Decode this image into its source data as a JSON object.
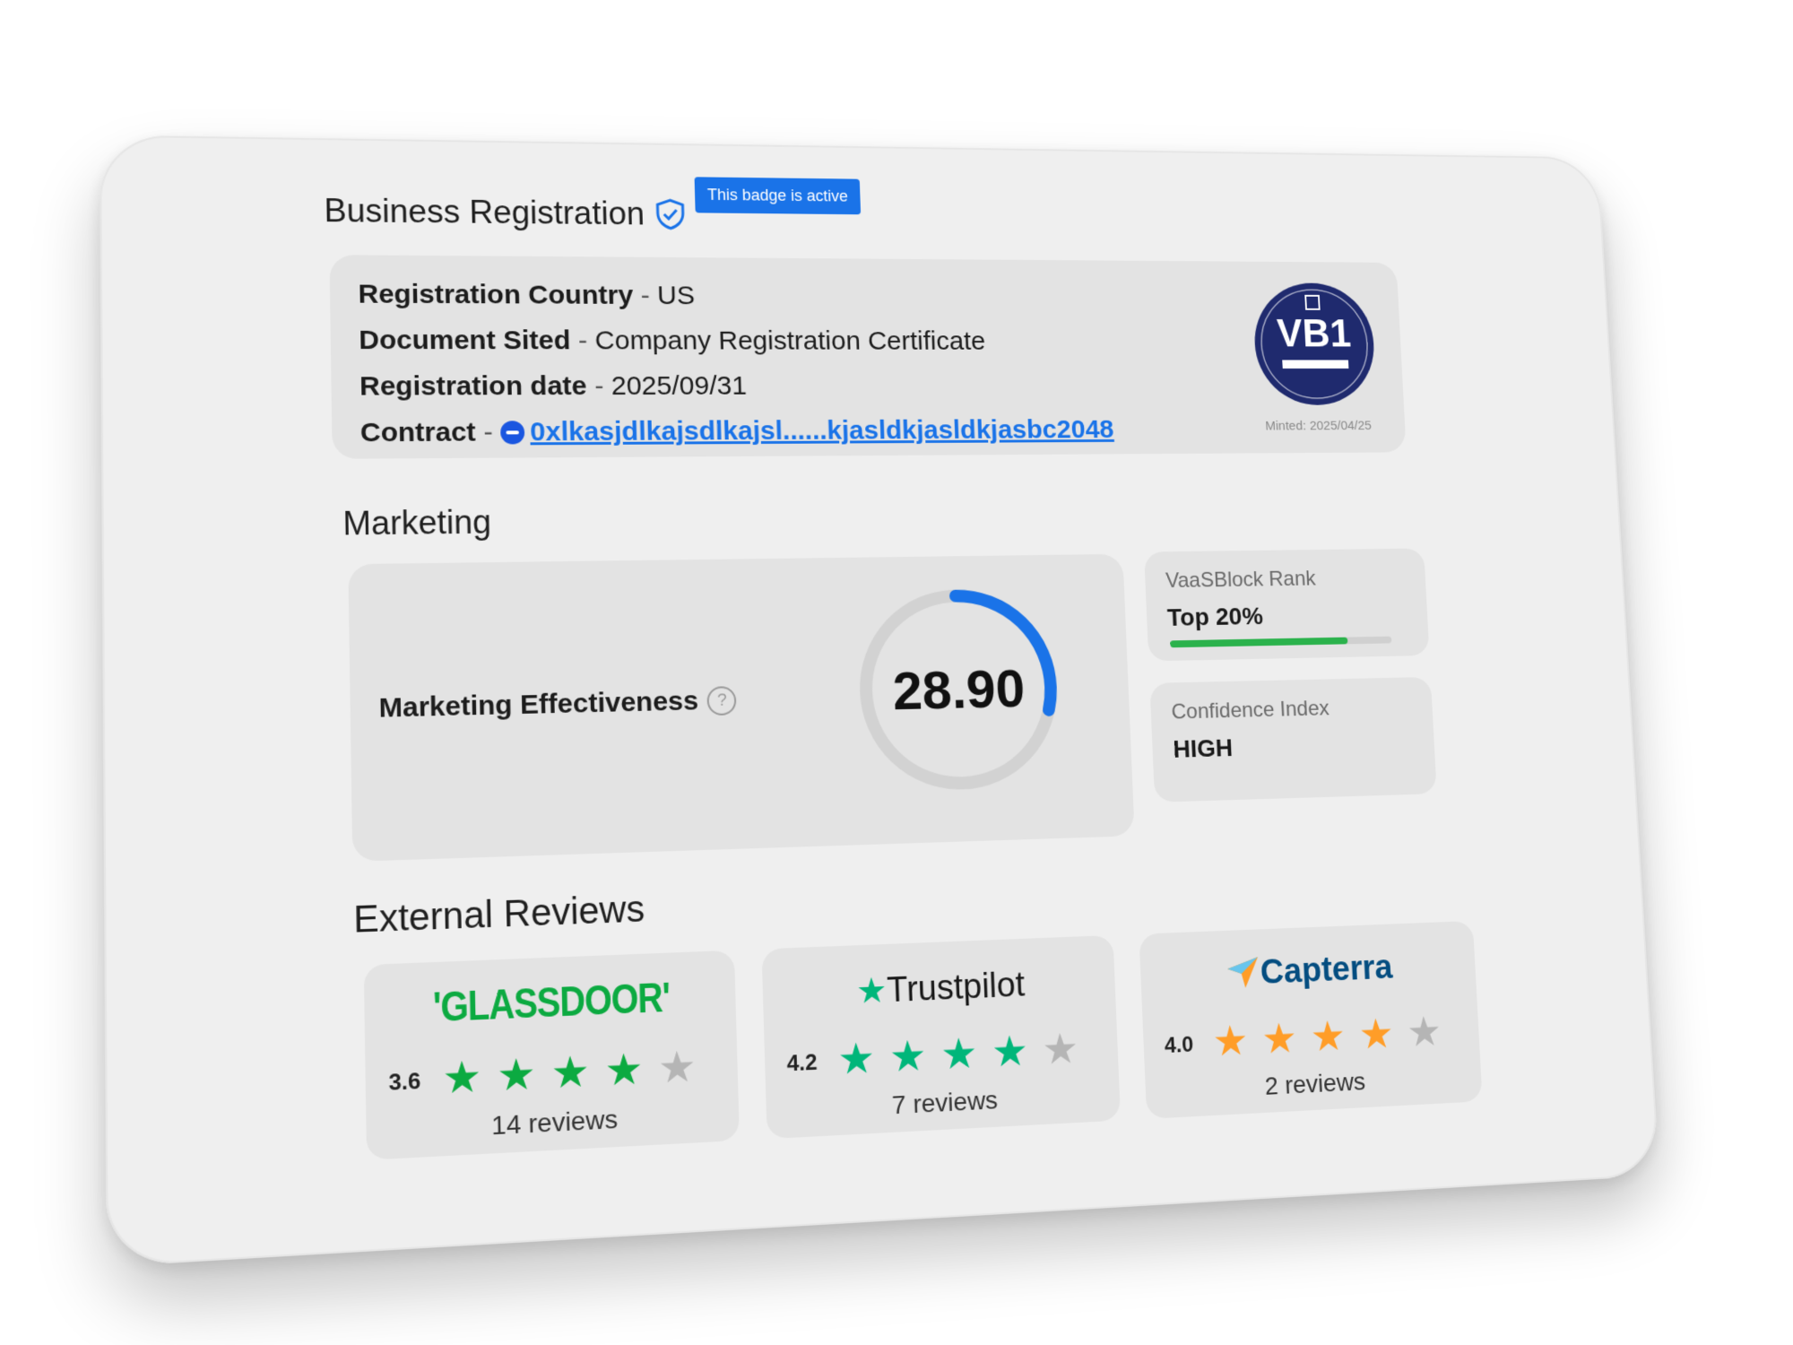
{
  "business_registration": {
    "title": "Business Registration",
    "badge_status": "This badge is active",
    "rows": [
      {
        "key": "Registration Country",
        "sep": " - ",
        "value": "US"
      },
      {
        "key": "Document Sited",
        "sep": " - ",
        "value": "Company Registration Certificate"
      },
      {
        "key": "Registration date",
        "sep": " - ",
        "value": "2025/09/31"
      }
    ],
    "contract": {
      "key": "Contract",
      "sep": " - ",
      "address": "0xlkasjdlkajsdlkajsl......kjasldkjasldkjasbc2048"
    },
    "seal": {
      "text": "VB1",
      "minted": "Minted: 2025/04/25"
    }
  },
  "marketing": {
    "title": "Marketing",
    "effectiveness_label": "Marketing Effectiveness",
    "effectiveness_value": "28.90",
    "effectiveness_fraction": 0.289,
    "rank": {
      "label": "VaaSBlock Rank",
      "value": "Top 20%",
      "progress": 0.8
    },
    "confidence": {
      "label": "Confidence Index",
      "value": "HIGH"
    }
  },
  "external_reviews": {
    "title": "External Reviews",
    "items": [
      {
        "name": "'GLASSDOOR'",
        "rating": "3.6",
        "stars": 4,
        "reviews": "14 reviews",
        "star_color": "#0caa41"
      },
      {
        "name": "Trustpilot",
        "rating": "4.2",
        "stars": 4,
        "reviews": "7 reviews",
        "star_color": "#00b67a"
      },
      {
        "name": "Capterra",
        "rating": "4.0",
        "stars": 4,
        "reviews": "2 reviews",
        "star_color": "#ff9d28"
      }
    ]
  },
  "colors": {
    "accent": "#1a73e8",
    "rank_bar": "#2bb24c",
    "empty_star": "#b5b5b5"
  }
}
